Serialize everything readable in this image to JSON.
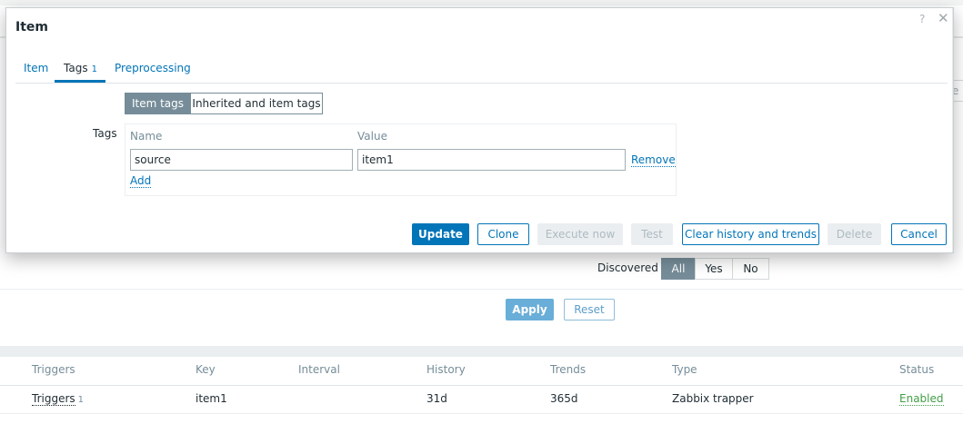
{
  "background": {
    "edge_button_label": "e",
    "filter": {
      "discovered_label": "Discovered",
      "discovered_options": [
        "All",
        "Yes",
        "No"
      ],
      "discovered_selected": "All",
      "apply_label": "Apply",
      "reset_label": "Reset"
    },
    "table": {
      "headers": [
        "Triggers",
        "Key",
        "Interval",
        "History",
        "Trends",
        "Type",
        "Status"
      ],
      "rows": [
        {
          "triggers": "Triggers",
          "triggers_count": "1",
          "key": "item1",
          "interval": "",
          "history": "31d",
          "trends": "365d",
          "type": "Zabbix trapper",
          "status": "Enabled"
        }
      ]
    }
  },
  "modal": {
    "title": "Item",
    "help_glyph": "?",
    "close_glyph": "✕",
    "tabs": [
      {
        "label": "Item"
      },
      {
        "label": "Tags",
        "count": "1"
      },
      {
        "label": "Preprocessing"
      }
    ],
    "active_tab": "Tags",
    "tag_mode_options": [
      "Item tags",
      "Inherited and item tags"
    ],
    "tag_mode_selected": "Item tags",
    "tags_label": "Tags",
    "columns": {
      "name": "Name",
      "value": "Value"
    },
    "tags": [
      {
        "name": "source",
        "value": "item1",
        "remove_label": "Remove"
      }
    ],
    "add_label": "Add",
    "buttons": {
      "update": "Update",
      "clone": "Clone",
      "execute_now": "Execute now",
      "test": "Test",
      "clear_history": "Clear history and trends",
      "delete": "Delete",
      "cancel": "Cancel"
    }
  },
  "colors": {
    "accent": "#0275b8",
    "segment_selected": "#768d99",
    "status_enabled": "#429e47"
  }
}
